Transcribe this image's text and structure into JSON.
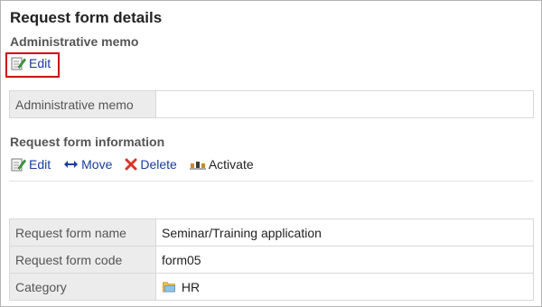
{
  "page_title": "Request form details",
  "admin_memo_section": {
    "title": "Administrative memo",
    "edit_label": "Edit",
    "table": {
      "label": "Administrative memo",
      "value": ""
    }
  },
  "request_form_section": {
    "title": "Request form information",
    "toolbar": {
      "edit_label": "Edit",
      "move_label": "Move",
      "delete_label": "Delete",
      "activate_label": "Activate"
    },
    "rows": [
      {
        "label": "Request form name",
        "value": "Seminar/Training application"
      },
      {
        "label": "Request form code",
        "value": "form05"
      },
      {
        "label": "Category",
        "value": "HR"
      }
    ]
  },
  "colors": {
    "link": "#1a3d9e",
    "highlight": "#d0021b",
    "header_cell": "#ececec"
  }
}
